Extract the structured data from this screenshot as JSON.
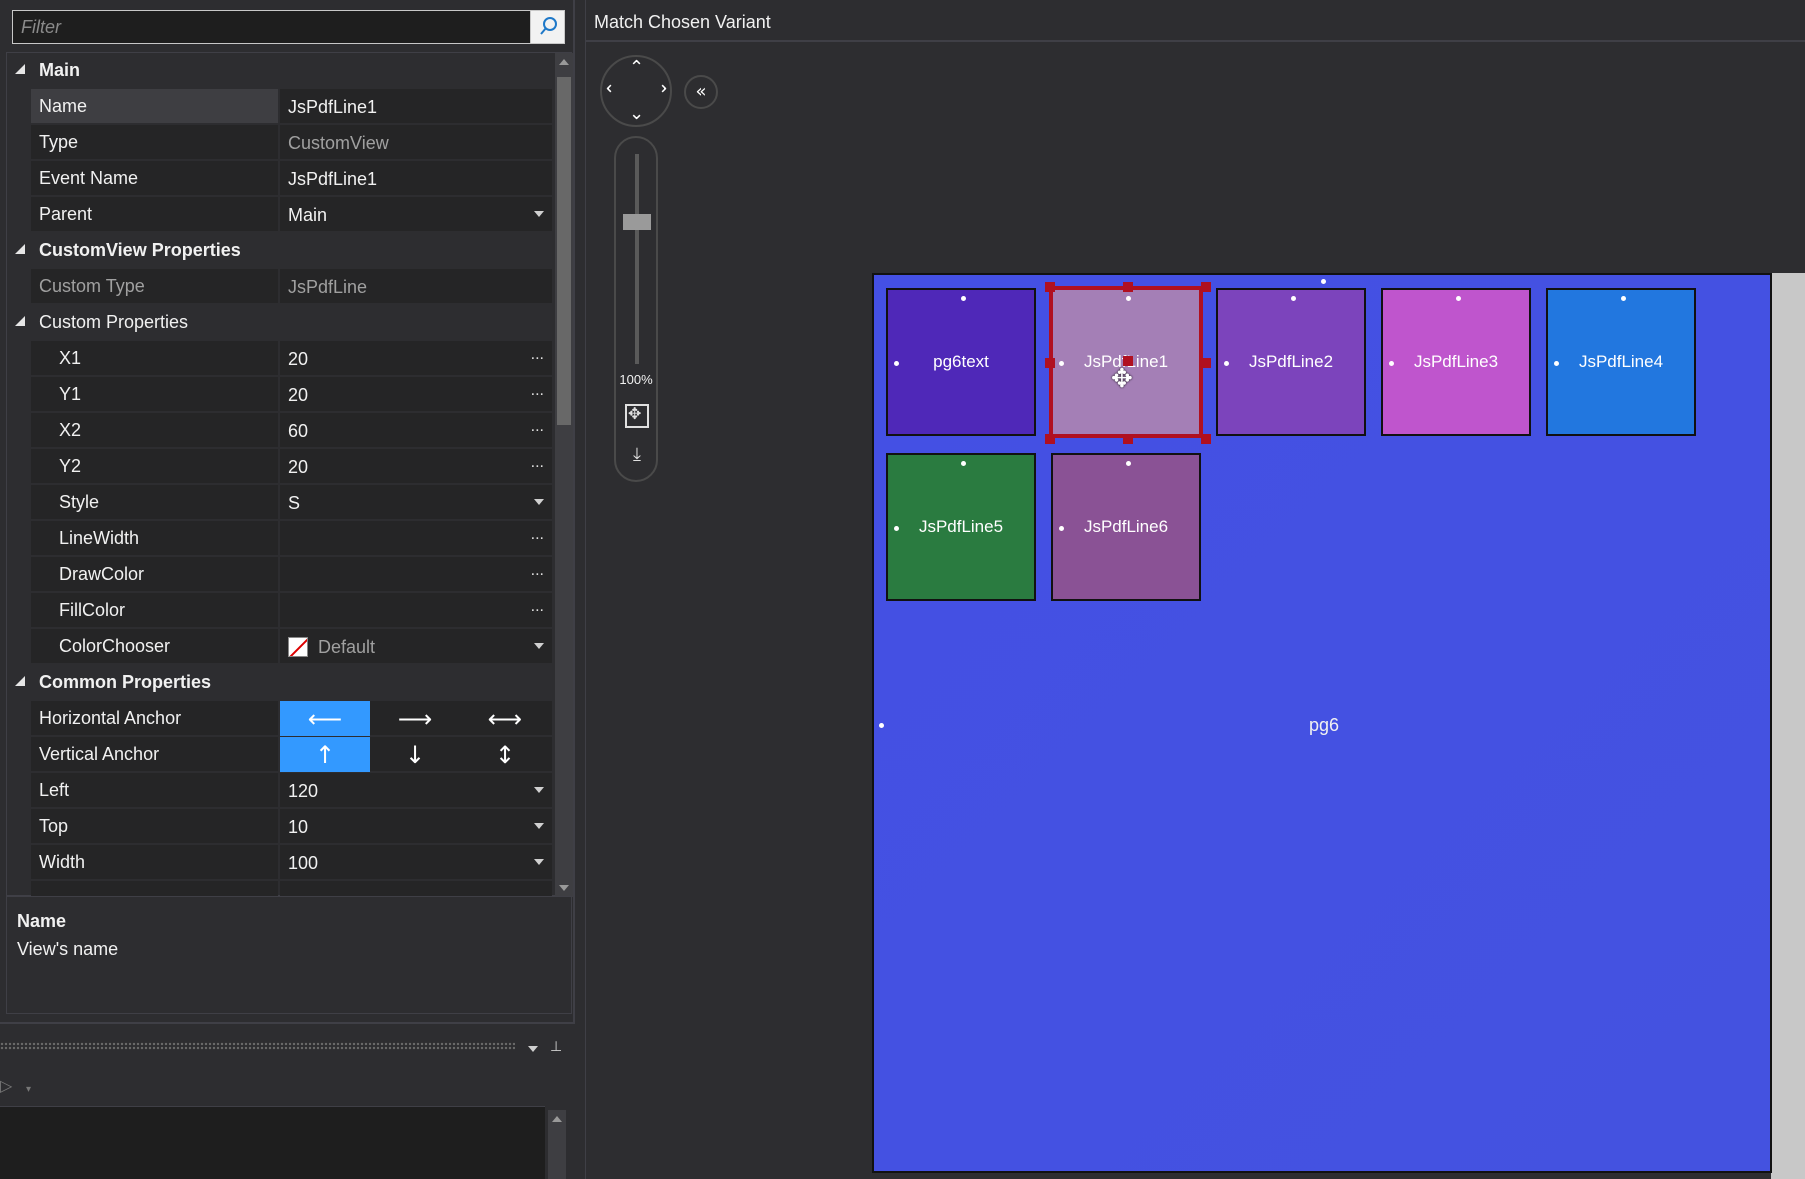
{
  "filter": {
    "placeholder": "Filter",
    "icon": "search-icon"
  },
  "property_grid": {
    "categories": {
      "main": "Main",
      "customview": "CustomView Properties",
      "custom_props": "Custom Properties",
      "common": "Common Properties"
    },
    "main": {
      "name": {
        "label": "Name",
        "value": "JsPdfLine1"
      },
      "type": {
        "label": "Type",
        "value": "CustomView"
      },
      "event_name": {
        "label": "Event Name",
        "value": "JsPdfLine1"
      },
      "parent": {
        "label": "Parent",
        "value": "Main"
      }
    },
    "customview": {
      "custom_type": {
        "label": "Custom Type",
        "value": "JsPdfLine"
      }
    },
    "custom": {
      "x1": {
        "label": "X1",
        "value": "20"
      },
      "y1": {
        "label": "Y1",
        "value": "20"
      },
      "x2": {
        "label": "X2",
        "value": "60"
      },
      "y2": {
        "label": "Y2",
        "value": "20"
      },
      "style": {
        "label": "Style",
        "value": "S"
      },
      "linewidth": {
        "label": "LineWidth",
        "value": ""
      },
      "drawcolor": {
        "label": "DrawColor",
        "value": ""
      },
      "fillcolor": {
        "label": "FillColor",
        "value": ""
      },
      "colorchooser": {
        "label": "ColorChooser",
        "value": "Default"
      },
      "ellipsis": "..."
    },
    "common": {
      "h_anchor": {
        "label": "Horizontal Anchor",
        "selected": "left"
      },
      "v_anchor": {
        "label": "Vertical Anchor",
        "selected": "top"
      },
      "left": {
        "label": "Left",
        "value": "120"
      },
      "top": {
        "label": "Top",
        "value": "10"
      },
      "width": {
        "label": "Width",
        "value": "100"
      }
    }
  },
  "description": {
    "title": "Name",
    "text": "View's name"
  },
  "designer": {
    "title": "Match Chosen Variant",
    "zoom": "100%",
    "nav_icons": [
      "arrow-up-icon",
      "arrow-down-icon",
      "arrow-left-icon",
      "arrow-right-icon"
    ],
    "collapse_icon": "double-chevron-left-icon",
    "collapse_glyph": "«",
    "parent_view": {
      "label": "pg6",
      "color": "#4452e2"
    },
    "views": [
      {
        "name": "pg6text",
        "color": "#4f28b8"
      },
      {
        "name": "JsPdfLine1",
        "color": "#a47fb6",
        "selected": true
      },
      {
        "name": "JsPdfLine2",
        "color": "#7c44bc"
      },
      {
        "name": "JsPdfLine3",
        "color": "#bf55cd"
      },
      {
        "name": "JsPdfLine4",
        "color": "#2277df"
      },
      {
        "name": "JsPdfLine5",
        "color": "#2a7b40"
      },
      {
        "name": "JsPdfLine6",
        "color": "#8a5295"
      }
    ]
  },
  "colors": {
    "accent": "#3399ff",
    "selection": "#b01020",
    "bg": "#2d2d30",
    "cell": "#252526"
  }
}
